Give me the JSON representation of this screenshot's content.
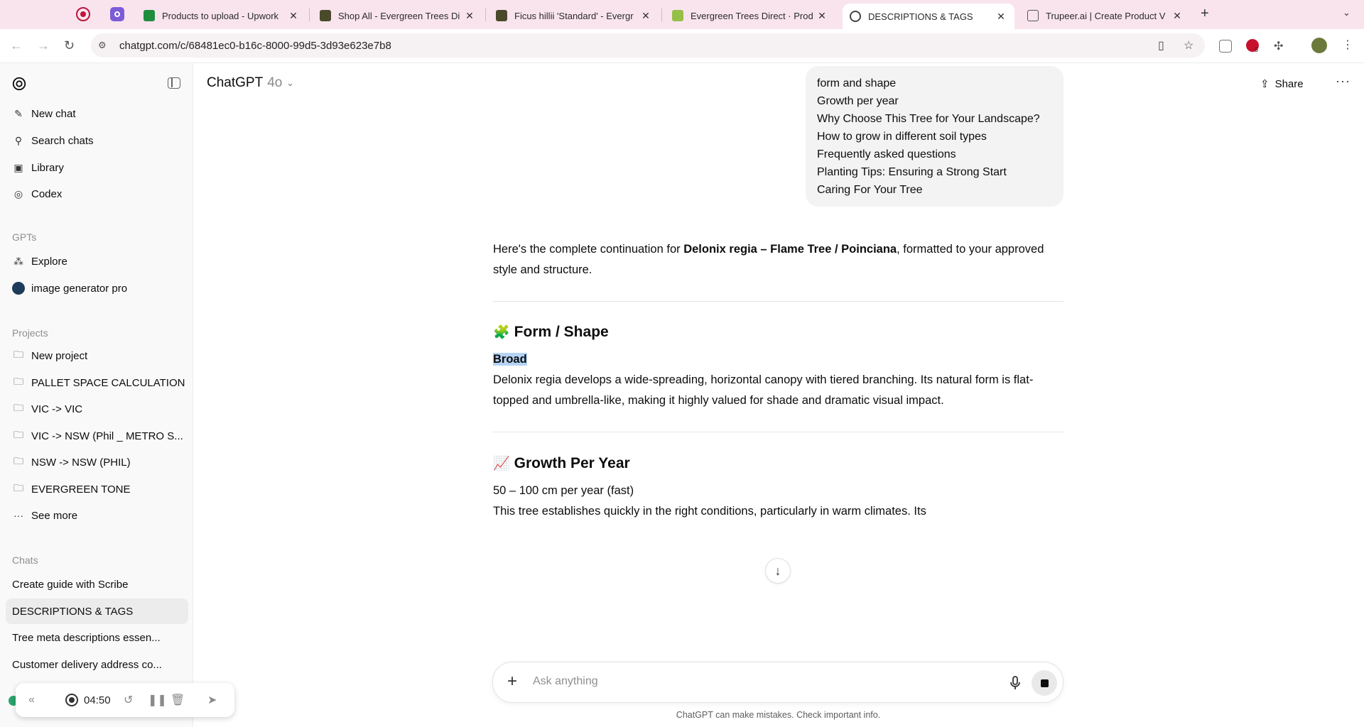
{
  "browser": {
    "tabs": [
      {
        "title": "Products to upload - Upwork",
        "favicon_color": "#1e8e3e"
      },
      {
        "title": "Shop All - Evergreen Trees Di",
        "favicon_color": "#4a4a2a"
      },
      {
        "title": "Ficus hillii 'Standard' - Evergr",
        "favicon_color": "#4a4a2a"
      },
      {
        "title": "Evergreen Trees Direct · Prod",
        "favicon_color": "#95bf47"
      },
      {
        "title": "DESCRIPTIONS & TAGS",
        "favicon_color": "#444444"
      },
      {
        "title": "Trupeer.ai | Create Product V",
        "favicon_color": "#555555"
      }
    ],
    "url": "chatgpt.com/c/68481ec0-b16c-8000-99d5-3d93e623e7b8",
    "extension_badge": "5"
  },
  "sidebar": {
    "top_items": [
      {
        "label": "New chat",
        "icon": "new-chat-icon"
      },
      {
        "label": "Search chats",
        "icon": "search-icon"
      },
      {
        "label": "Library",
        "icon": "library-icon"
      },
      {
        "label": "Codex",
        "icon": "codex-icon"
      }
    ],
    "gpts_heading": "GPTs",
    "gpts": [
      {
        "label": "Explore",
        "icon": "grid-icon"
      },
      {
        "label": "image generator pro",
        "icon": "gpt-avatar-icon"
      }
    ],
    "projects_heading": "Projects",
    "projects": [
      {
        "label": "New project",
        "icon": "folder-plus-icon"
      },
      {
        "label": "PALLET SPACE CALCULATION",
        "icon": "folder-icon"
      },
      {
        "label": "VIC -> VIC",
        "icon": "folder-icon"
      },
      {
        "label": "VIC -> NSW (Phil _ METRO S...",
        "icon": "folder-icon"
      },
      {
        "label": "NSW -> NSW (PHIL)",
        "icon": "folder-icon"
      },
      {
        "label": "EVERGREEN TONE",
        "icon": "folder-icon"
      },
      {
        "label": "See more",
        "icon": "ellipsis-icon"
      }
    ],
    "chats_heading": "Chats",
    "chats": [
      {
        "label": "Create guide with Scribe",
        "selected": false
      },
      {
        "label": "DESCRIPTIONS & TAGS",
        "selected": true
      },
      {
        "label": "Tree meta descriptions essen...",
        "selected": false
      },
      {
        "label": "Customer delivery address co...",
        "selected": false
      }
    ]
  },
  "recorder": {
    "time": "04:50"
  },
  "header": {
    "title": "ChatGPT",
    "model": "4o",
    "share_label": "Share"
  },
  "user_message": {
    "lines": [
      "form and shape",
      "Growth per year",
      "Why Choose This Tree for Your Landscape?",
      "How to grow in different soil types",
      "Frequently asked questions",
      "Planting Tips: Ensuring a Strong Start",
      "Caring For Your Tree"
    ]
  },
  "assistant": {
    "intro_prefix": "Here's the complete continuation for ",
    "intro_bold": "Delonix regia – Flame Tree / Poinciana",
    "intro_suffix": ", formatted to your approved style and structure.",
    "section1": {
      "emoji": "🧩",
      "heading": "Form / Shape",
      "subheading": "Broad",
      "body": "Delonix regia develops a wide-spreading, horizontal canopy with tiered branching. Its natural form is flat-topped and umbrella-like, making it highly valued for shade and dramatic visual impact."
    },
    "section2": {
      "emoji": "📈",
      "heading": "Growth Per Year",
      "rate": "50 – 100 cm per year (fast)",
      "body": "This tree establishes quickly in the right conditions, particularly in warm climates. Its"
    }
  },
  "composer": {
    "placeholder": "Ask anything"
  },
  "disclaimer": "ChatGPT can make mistakes. Check important info."
}
